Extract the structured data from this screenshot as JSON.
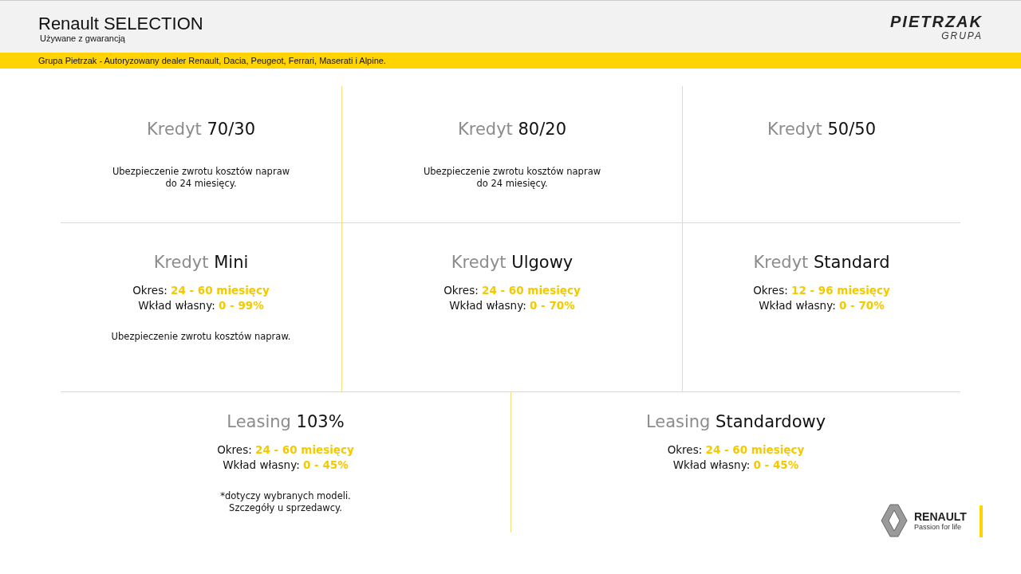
{
  "header": {
    "title": "Renault SELECTION",
    "subtitle": "Używane z gwarancją",
    "brand": {
      "name": "PIETRZAK",
      "sub": "GRUPA"
    }
  },
  "banner": "Grupa Pietrzak - Autoryzowany dealer Renault, Dacia, Peugeot, Ferrari, Maserati i Alpine.",
  "rows": [
    {
      "offers": [
        {
          "prefix": "Kredyt",
          "name": "70/30",
          "notes": [
            "Ubezpieczenie zwrotu kosztów napraw",
            "do 24 miesięcy."
          ]
        },
        {
          "prefix": "Kredyt",
          "name": "80/20",
          "notes": [
            "Ubezpieczenie zwrotu kosztów napraw",
            "do 24 miesięcy."
          ]
        },
        {
          "prefix": "Kredyt",
          "name": "50/50"
        }
      ]
    },
    {
      "offers": [
        {
          "prefix": "Kredyt",
          "name": "Mini",
          "details": [
            {
              "label": "Okres:",
              "value": "24 - 60 miesięcy"
            },
            {
              "label": "Wkład własny:",
              "value": "0 - 99%"
            }
          ],
          "notes": [
            "Ubezpieczenie zwrotu kosztów napraw."
          ]
        },
        {
          "prefix": "Kredyt",
          "name": "Ulgowy",
          "details": [
            {
              "label": "Okres:",
              "value": "24 - 60 miesięcy"
            },
            {
              "label": "Wkład własny:",
              "value": "0 - 70%"
            }
          ]
        },
        {
          "prefix": "Kredyt",
          "name": "Standard",
          "details": [
            {
              "label": "Okres:",
              "value": "12 - 96 miesięcy"
            },
            {
              "label": "Wkład własny:",
              "value": "0 - 70%"
            }
          ]
        }
      ]
    },
    {
      "offers": [
        {
          "prefix": "Leasing",
          "name": "103%",
          "details": [
            {
              "label": "Okres:",
              "value": "24 - 60 miesięcy"
            },
            {
              "label": "Wkład własny:",
              "value": "0 - 45%"
            }
          ],
          "notes": [
            "*dotyczy wybranych modeli.",
            "Szczegóły u sprzedawcy."
          ]
        },
        {
          "prefix": "Leasing",
          "name": "Standardowy",
          "details": [
            {
              "label": "Okres:",
              "value": "24 - 60 miesięcy"
            },
            {
              "label": "Wkład własny:",
              "value": "0 - 45%"
            }
          ]
        }
      ]
    }
  ],
  "footer_logo": {
    "name": "RENAULT",
    "tagline": "Passion for life"
  }
}
